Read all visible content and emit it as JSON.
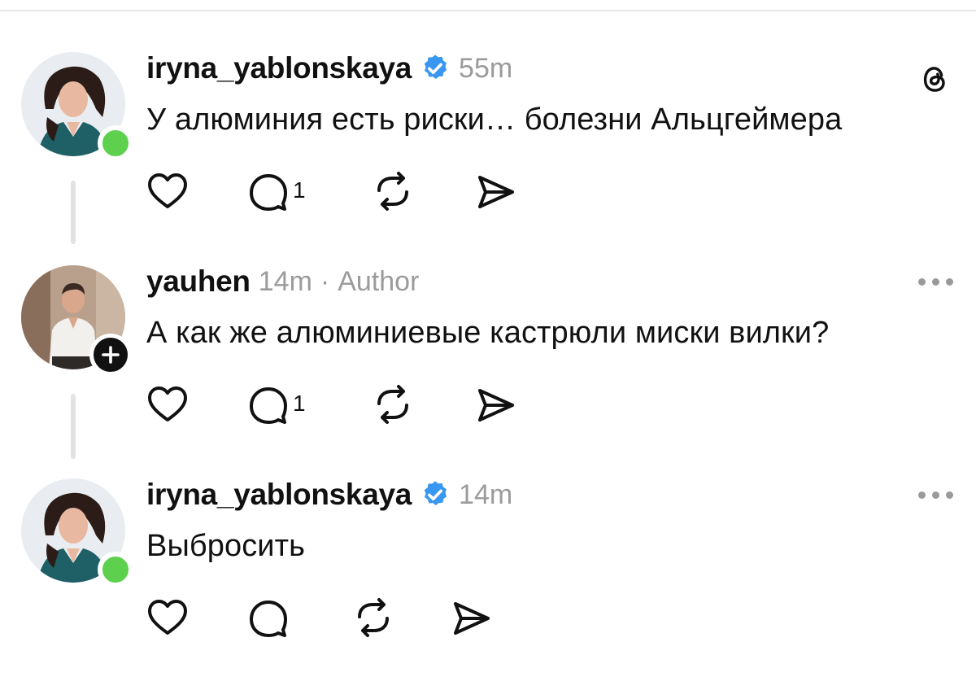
{
  "posts": [
    {
      "username": "iryna_yablonskaya",
      "verified": true,
      "time": "55m",
      "author_tag": "",
      "text": "У алюминия есть риски… болезни Альцгеймера",
      "reply_count": "1",
      "right_control": "threads-logo-icon",
      "avatar_badge": "online-status"
    },
    {
      "username": "yauhen",
      "verified": false,
      "time": "14m",
      "separator": "·",
      "author_tag": "Author",
      "text": "А как же алюминиевые кастрюли миски вилки?",
      "reply_count": "1",
      "right_control": "more-options-icon",
      "avatar_badge": "follow-plus"
    },
    {
      "username": "iryna_yablonskaya",
      "verified": true,
      "time": "14m",
      "author_tag": "",
      "text": "Выбросить",
      "reply_count": "",
      "right_control": "more-options-icon",
      "avatar_badge": "online-status"
    }
  ],
  "colors": {
    "verified_badge": "#3897f0",
    "online_dot": "#5dd04e",
    "meta_text": "#9b9b9b",
    "thread_line": "#e3e3e3"
  }
}
